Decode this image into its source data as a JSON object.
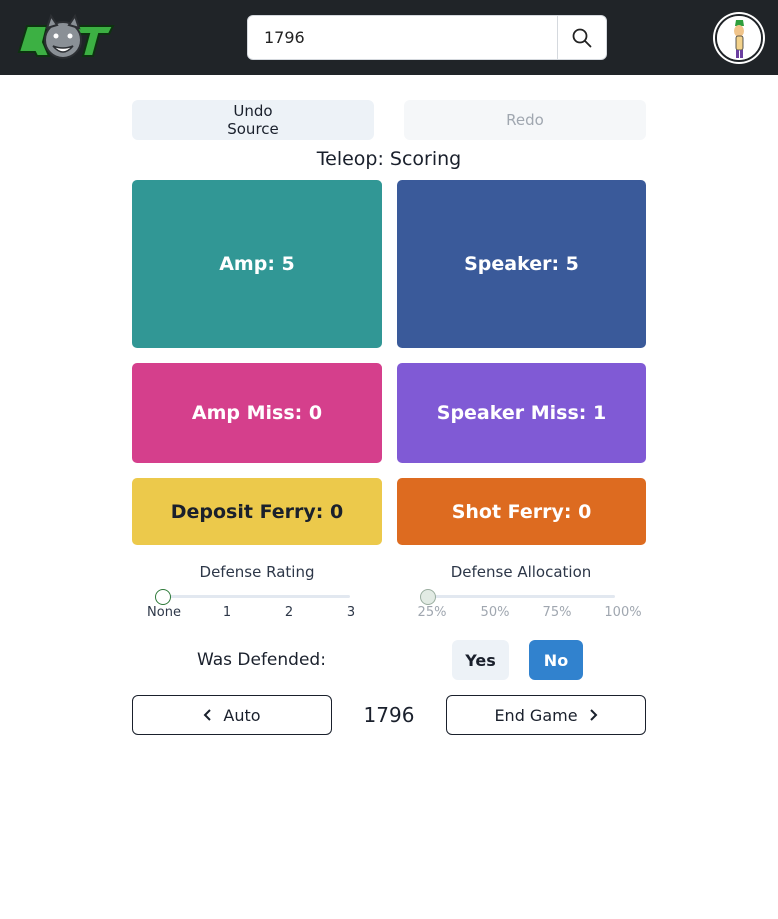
{
  "header": {
    "search": {
      "value": "1796",
      "placeholder": ""
    }
  },
  "history": {
    "undo_line1": "Undo",
    "undo_line2": "Source",
    "redo": "Redo"
  },
  "section_title": "Teleop: Scoring",
  "tiles": {
    "amp": "Amp: 5",
    "speaker": "Speaker: 5",
    "amp_miss": "Amp Miss: 0",
    "speaker_miss": "Speaker Miss: 1",
    "deposit_ferry": "Deposit Ferry: 0",
    "shot_ferry": "Shot Ferry: 0"
  },
  "defense_rating": {
    "label": "Defense Rating",
    "ticks": [
      "None",
      "1",
      "2",
      "3"
    ],
    "selected": "None"
  },
  "defense_allocation": {
    "label": "Defense Allocation",
    "ticks": [
      "25%",
      "50%",
      "75%",
      "100%"
    ],
    "selected": "25%"
  },
  "was_defended": {
    "label": "Was Defended:",
    "yes": "Yes",
    "no": "No",
    "selected": "No"
  },
  "footer": {
    "prev": "Auto",
    "team": "1796",
    "next": "End Game"
  },
  "colors": {
    "amp": "#319795",
    "speaker": "#3a5a9a",
    "amp_miss": "#d53f8c",
    "speaker_miss": "#805ad5",
    "deposit_ferry": "#ecc94b",
    "shot_ferry": "#dd6b20",
    "primary": "#3182ce",
    "header_bg": "#202428"
  }
}
